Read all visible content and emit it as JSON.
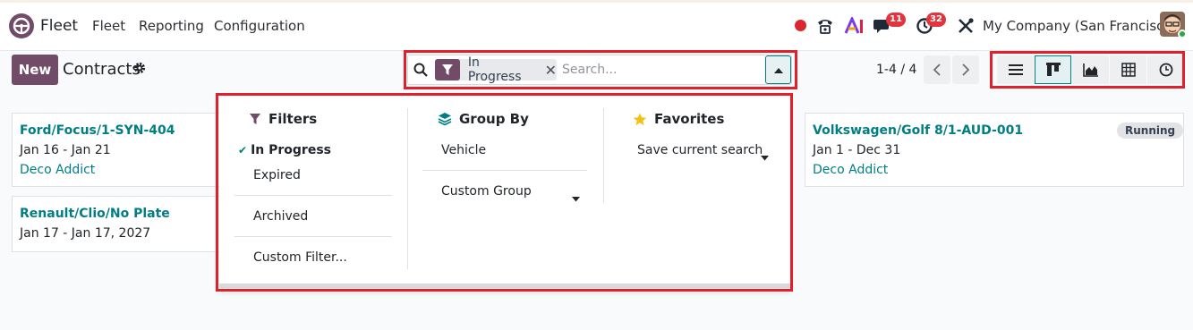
{
  "navbar": {
    "app_name": "Fleet",
    "menus": [
      "Fleet",
      "Reporting",
      "Configuration"
    ],
    "messages_count": "11",
    "activities_count": "32",
    "company": "My Company (San Francisco)"
  },
  "control_panel": {
    "new_label": "New",
    "title": "Contracts",
    "search": {
      "facet_label": "In Progress",
      "placeholder": "Search..."
    },
    "pager": "1-4 / 4",
    "views": [
      "list-view",
      "kanban-view",
      "graph-view",
      "pivot-view",
      "activity-view"
    ],
    "active_view": "kanban-view"
  },
  "cards": [
    {
      "title": "Ford/Focus/1-SYN-404",
      "dates": "Jan 16 - Jan 21",
      "partner": "Deco Addict"
    },
    {
      "title": "Renault/Clio/No Plate",
      "dates": "Jan 17 - Jan 17, 2027"
    },
    {
      "title": "Volkswagen/Golf 8/1-AUD-001",
      "dates": "Jan 1 - Dec 31",
      "partner": "Deco Addict",
      "state": "Running"
    }
  ],
  "dropdown": {
    "filters": {
      "header": "Filters",
      "items": [
        "In Progress",
        "Expired",
        "Archived",
        "Custom Filter..."
      ]
    },
    "group_by": {
      "header": "Group By",
      "items": [
        "Vehicle",
        "Custom Group"
      ]
    },
    "favorites": {
      "header": "Favorites",
      "items": [
        "Save current search"
      ]
    }
  },
  "colors": {
    "brand": "#714b67",
    "accent": "#017e84",
    "highlight_box": "#e2202c",
    "badge": "#e0343f"
  }
}
